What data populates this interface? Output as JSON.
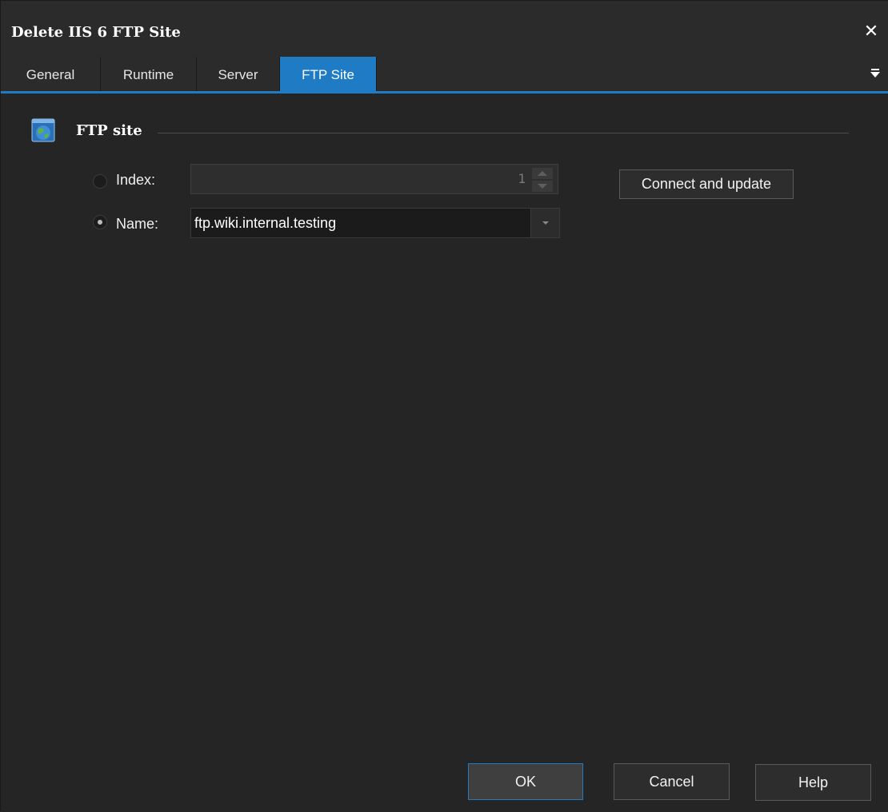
{
  "window": {
    "title": "Delete IIS 6 FTP Site",
    "close_glyph": "✕"
  },
  "tabs": [
    {
      "label": "General",
      "active": false
    },
    {
      "label": "Runtime",
      "active": false
    },
    {
      "label": "Server",
      "active": false
    },
    {
      "label": "FTP Site",
      "active": true
    }
  ],
  "group": {
    "label": "FTP site",
    "icon": "globe-window-icon"
  },
  "index_option": {
    "label": "Index:",
    "selected": false,
    "value": "1",
    "enabled": false
  },
  "name_option": {
    "label": "Name:",
    "selected": true,
    "value": "ftp.wiki.internal.testing"
  },
  "buttons": {
    "connect_update": "Connect and update",
    "ok": "OK",
    "cancel": "Cancel",
    "help": "Help"
  },
  "colors": {
    "accent": "#1e7bc4",
    "background": "#252525"
  }
}
